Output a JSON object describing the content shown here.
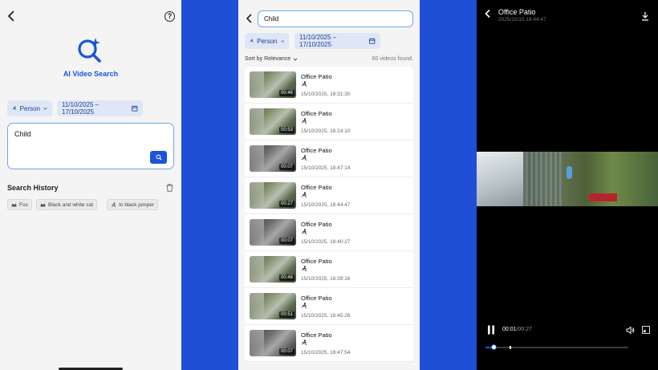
{
  "colors": {
    "accent": "#1a55d8",
    "background_blue": "#1f4fd6",
    "panel_bg": "#f4f4f5",
    "player_bg": "#000000"
  },
  "search_screen": {
    "app_title": "AI Video Search",
    "filter_object": "Person",
    "filter_date": "11/10/2025 – 17/10/2025",
    "query": "Child",
    "history_title": "Search History",
    "history": [
      "Fox",
      "Black and white cat",
      "In black jumper"
    ]
  },
  "results_screen": {
    "query": "Child",
    "filter_object": "Person",
    "filter_date": "11/10/2025 – 17/10/2025",
    "sort_label": "Sort by Relevance",
    "count_text": "60 videos found.",
    "items": [
      {
        "title": "Office Patio",
        "duration": "00:46",
        "time": "15/10/2025, 18:31:30",
        "tone": "color"
      },
      {
        "title": "Office Patio",
        "duration": "00:53",
        "time": "15/10/2025, 18:24:10",
        "tone": "color"
      },
      {
        "title": "Office Patio",
        "duration": "00:07",
        "time": "15/10/2025, 18:47:14",
        "tone": "gray"
      },
      {
        "title": "Office Patio",
        "duration": "00:27",
        "time": "15/10/2025, 18:44:47",
        "tone": "color"
      },
      {
        "title": "Office Patio",
        "duration": "00:07",
        "time": "15/10/2025, 18:40:27",
        "tone": "gray"
      },
      {
        "title": "Office Patio",
        "duration": "00:48",
        "time": "15/10/2025, 18:39:16",
        "tone": "color"
      },
      {
        "title": "Office Patio",
        "duration": "00:51",
        "time": "15/10/2025, 18:45:28",
        "tone": "color"
      },
      {
        "title": "Office Patio",
        "duration": "00:07",
        "time": "15/10/2025, 18:47:54",
        "tone": "gray"
      }
    ]
  },
  "player_screen": {
    "title": "Office Patio",
    "timestamp": "2025/10/15 18:44:47",
    "current_time": "00:01",
    "total_time": "/00:27",
    "progress": 0.06
  }
}
